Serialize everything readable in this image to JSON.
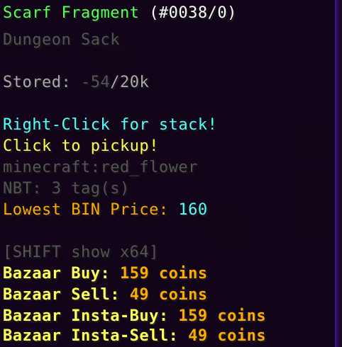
{
  "tooltip": {
    "title": {
      "name": "Scarf Fragment",
      "id": "(#0038/0)",
      "name_color": "#55ff55",
      "id_color": "#ffffff"
    },
    "subtitle": "Dungeon Sack",
    "stored": {
      "label": "Stored: ",
      "value": "-54",
      "sep": "/",
      "capacity": "20k"
    },
    "right_click": "Right-Click for stack!",
    "click_pickup": "Click to pickup!",
    "registry_id": "minecraft:red_flower",
    "nbt": "NBT: 3 tag(s)",
    "lowest_bin": {
      "label": "Lowest BIN Price: ",
      "value": "160"
    },
    "shift_hint": "[SHIFT show x64]",
    "bazaar": [
      {
        "label": "Bazaar Buy: ",
        "value": "159 coins"
      },
      {
        "label": "Bazaar Sell: ",
        "value": "49 coins"
      },
      {
        "label": "Bazaar Insta-Buy: ",
        "value": "159 coins"
      },
      {
        "label": "Bazaar Insta-Sell: ",
        "value": "49 coins"
      }
    ]
  },
  "colors": {
    "green": "#55ff55",
    "white": "#ffffff",
    "gray": "#aaaaaa",
    "dark_gray": "#555555",
    "aqua": "#55ffff",
    "yellow": "#ffff55",
    "gold": "#ffaa00",
    "tooltip_border": "#2b0a5a"
  }
}
